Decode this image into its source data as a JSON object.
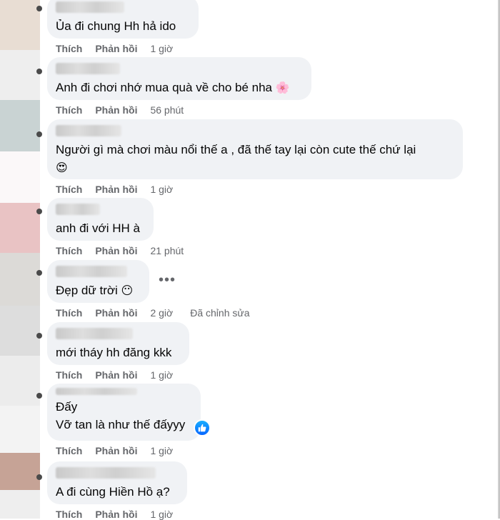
{
  "comments": [
    {
      "text": "Ủa đi chung Hh hả ido",
      "like": "Thích",
      "reply": "Phản hồi",
      "time": "1 giờ"
    },
    {
      "text": "Anh đi chơi nhớ mua quà về cho bé nha",
      "emoji": "🌸",
      "like": "Thích",
      "reply": "Phản hồi",
      "time": "56 phút"
    },
    {
      "text": "Người gì mà chơi màu nổi thế a , đã thế tay lại còn cute thế chứ lại",
      "emoji": "😍",
      "like": "Thích",
      "reply": "Phản hồi",
      "time": "1 giờ"
    },
    {
      "text": "anh đi với HH à",
      "like": "Thích",
      "reply": "Phản hồi",
      "time": "21 phút"
    },
    {
      "text": "Đẹp dữ trời",
      "emoji": "😶",
      "like": "Thích",
      "reply": "Phản hồi",
      "time": "2 giờ",
      "edited": "Đã chỉnh sửa"
    },
    {
      "text": "mới tháy hh đăng kkk",
      "like": "Thích",
      "reply": "Phản hồi",
      "time": "1 giờ"
    },
    {
      "line1": "Đấy",
      "line2": "Vỡ tan là như thế đấyyy",
      "reaction": "like-reaction",
      "like": "Thích",
      "reply": "Phản hồi",
      "time": "1 giờ"
    },
    {
      "text": "A đi cùng Hiền Hồ ạ?",
      "like": "Thích",
      "reply": "Phản hồi",
      "time": "1 giờ"
    }
  ],
  "more_icon": "more-horizontal-icon",
  "colors": {
    "bubble": "#f0f2f5",
    "meta": "#65676b",
    "text": "#050505",
    "like_badge": "#0866ff"
  }
}
